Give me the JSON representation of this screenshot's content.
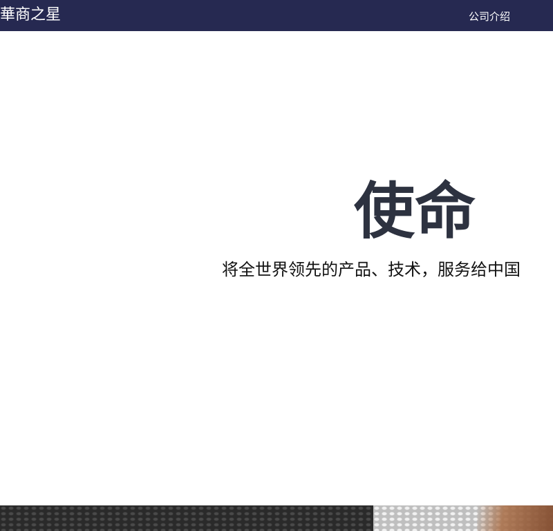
{
  "header": {
    "brand": "華商之星",
    "nav_about": "公司介绍"
  },
  "hero": {
    "title": "使命",
    "subtitle": "将全世界领先的产品、技术，服务给中国"
  },
  "colors": {
    "header_bg": "#262951",
    "title_color": "#2d3240"
  }
}
